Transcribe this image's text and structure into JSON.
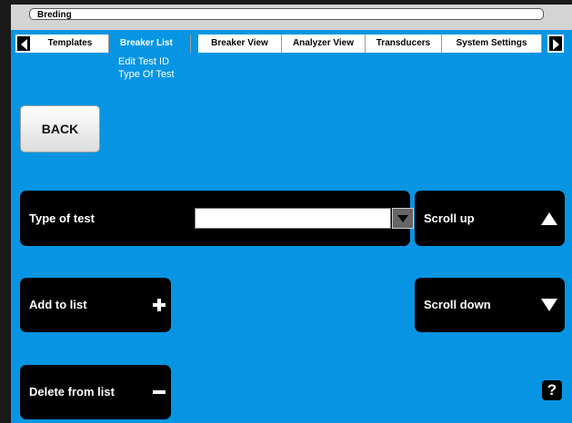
{
  "window": {
    "title": "Breding"
  },
  "tabs": [
    {
      "label": "Templates"
    },
    {
      "label": "Breaker List"
    },
    {
      "label": "Breaker View"
    },
    {
      "label": "Analyzer View"
    },
    {
      "label": "Transducers"
    },
    {
      "label": "System Settings"
    }
  ],
  "subnav": {
    "items": [
      "Edit Test ID",
      "Type Of Test"
    ]
  },
  "back": {
    "label": "BACK"
  },
  "type_of_test": {
    "label": "Type of test",
    "value": ""
  },
  "scroll_up": {
    "label": "Scroll up"
  },
  "scroll_down": {
    "label": "Scroll down"
  },
  "add_to_list": {
    "label": "Add to list"
  },
  "delete_from_list": {
    "label": "Delete from list"
  },
  "help": {
    "label": "?"
  },
  "colors": {
    "background": "#0795e3",
    "panel": "#000000",
    "text_on_panel": "#ffffff"
  }
}
